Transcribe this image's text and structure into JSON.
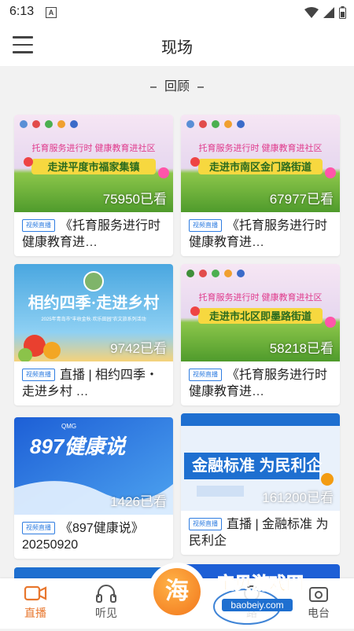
{
  "status": {
    "time": "6:13",
    "sim_label": "A"
  },
  "header": {
    "title": "现场"
  },
  "section": {
    "title": "回顾"
  },
  "cards": [
    {
      "tag": "视频直播",
      "title": "《托育服务进行时 健康教育进…",
      "views": "75950已看",
      "banner_text": "走进平度市福家集镇",
      "slogan": "托育服务进行时 健康教育进社区"
    },
    {
      "tag": "视频直播",
      "title": "《托育服务进行时 健康教育进…",
      "views": "67977已看",
      "banner_text": "走进市南区金门路街道",
      "slogan": "托育服务进行时 健康教育进社区"
    },
    {
      "tag": "视频直播",
      "title": "直播 | 相约四季・走进乡村 …",
      "views": "9742已看",
      "banner_text": "相约四季·走进乡村",
      "subtext": "2025年青岛市“丰收金秋·欢乐田园”农文旅系列活动"
    },
    {
      "tag": "视频直播",
      "title": "《托育服务进行时 健康教育进…",
      "views": "58218已看",
      "banner_text": "走进市北区即墨路街道",
      "slogan": "托育服务进行时 健康教育进社区"
    },
    {
      "tag": "视频直播",
      "title": "《897健康说》20250920",
      "views": "1426已看",
      "banner_text": "897健康说",
      "logo": "QMG"
    },
    {
      "tag": "视频直播",
      "title": "直播 | 金融标准 为民利企",
      "views": "161200已看",
      "banner_text": "金融标准 为民利企"
    }
  ],
  "nav": {
    "live": "直播",
    "listen": "听见",
    "center": "海",
    "road": "路",
    "radio": "电台"
  },
  "watermark": {
    "name": "宝贝游戏网",
    "url": "baobeiy.com"
  },
  "colors": {
    "accent": "#e8772e",
    "tag": "#2f7de1"
  }
}
